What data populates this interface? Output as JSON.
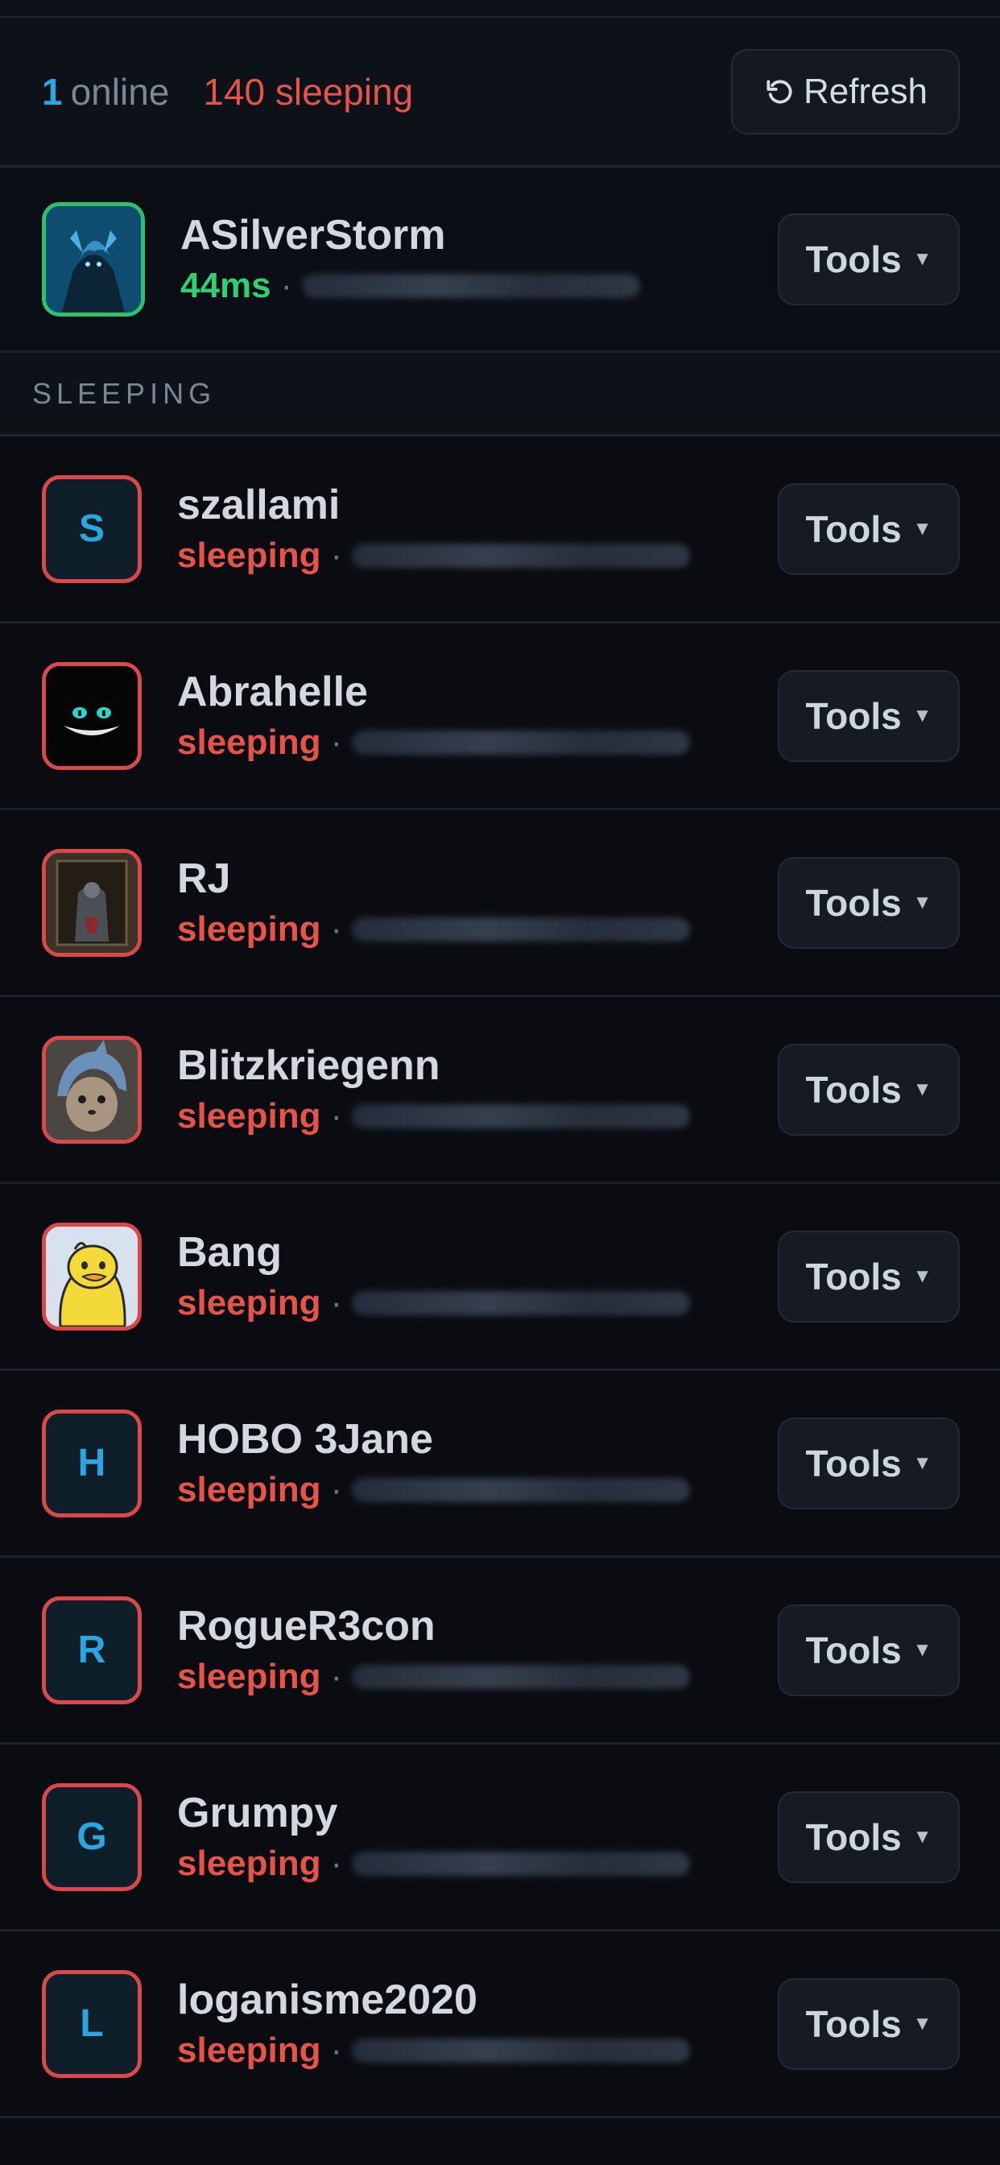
{
  "summary": {
    "online_count": "1",
    "online_label": "online",
    "sleeping_label": "140 sleeping",
    "refresh_label": "Refresh"
  },
  "online_players": [
    {
      "name": "ASilverStorm",
      "status": "44ms",
      "avatar_type": "image-dark-knight"
    }
  ],
  "sleeping_section": {
    "title": "SLEEPING"
  },
  "sleeping_players": [
    {
      "name": "szallami",
      "status": "sleeping",
      "avatar_letter": "S"
    },
    {
      "name": "Abrahelle",
      "status": "sleeping",
      "avatar_type": "image-grinning-cat"
    },
    {
      "name": "RJ",
      "status": "sleeping",
      "avatar_type": "image-throne"
    },
    {
      "name": "Blitzkriegenn",
      "status": "sleeping",
      "avatar_type": "image-shark-hood-cat"
    },
    {
      "name": "Bang",
      "status": "sleeping",
      "avatar_type": "image-yellow-duck"
    },
    {
      "name": "HOBO 3Jane",
      "status": "sleeping",
      "avatar_letter": "H"
    },
    {
      "name": "RogueR3con",
      "status": "sleeping",
      "avatar_letter": "R"
    },
    {
      "name": "Grumpy",
      "status": "sleeping",
      "avatar_letter": "G"
    },
    {
      "name": "loganisme2020",
      "status": "sleeping",
      "avatar_letter": "L"
    }
  ],
  "row_button_label": "Tools",
  "colors": {
    "online_accent": "#2aa7e0",
    "sleeping_red": "#e5534b",
    "ping_green": "#2fcf72",
    "background": "#0a0c11"
  }
}
